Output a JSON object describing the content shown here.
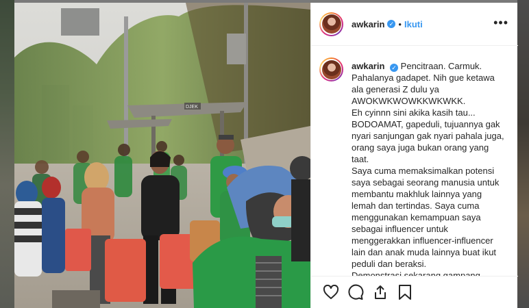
{
  "post": {
    "username": "awkarin",
    "verified_mark": "✓",
    "separator": "•",
    "follow_label": "Ikuti",
    "more_label": "•••",
    "caption_username": "awkarin",
    "caption_paragraphs": [
      "Pencitraan. Carmuk. Pahalanya gadapet. Nih gue ketawa ala generasi Z dulu ya AWOKWKWOWKKWKWKK.",
      "Eh cyinnn sini akika kasih tau... BODOAMAT, gapeduli, tujuannya gak nyari sanjungan gak nyari pahala juga, orang saya juga bukan orang yang taat.",
      "Saya cuma memaksimalkan potensi saya sebagai seorang manusia untuk membantu makhluk lainnya yang lemah dan tertindas. Saya cuma menggunakan kemampuan saya sebagai influencer untuk menggerakkan influencer-influencer lain dan anak muda lainnya buat ikut peduli dan beraksi.",
      "Demonstrasi sekarang gampang"
    ]
  },
  "photo": {
    "shelter_sign": "DJEK"
  },
  "actions": {
    "like_icon": "heart-icon",
    "comment_icon": "comment-icon",
    "share_icon": "share-icon",
    "save_icon": "bookmark-icon"
  },
  "colors": {
    "accent": "#3897f0",
    "text": "#262626",
    "border": "#efefef"
  }
}
